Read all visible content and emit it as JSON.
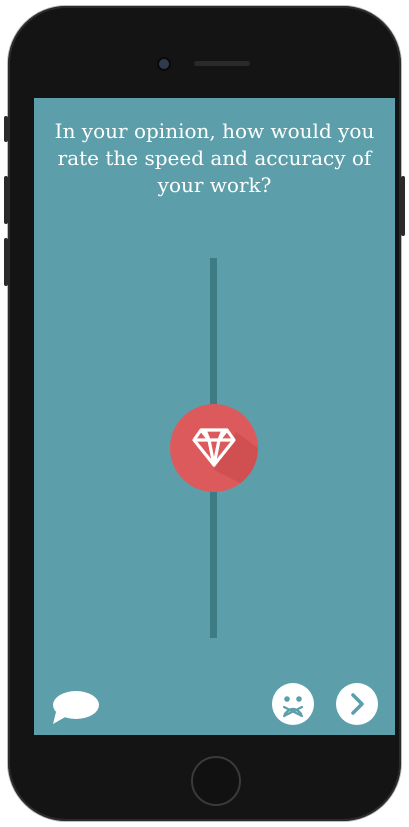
{
  "survey": {
    "question": "In your opinion, how would you rate the speed and accuracy of your work?"
  },
  "slider": {
    "thumb_icon": "diamond-icon",
    "value_fraction": 0.5
  },
  "controls": {
    "chat_icon": "speech-bubble-icon",
    "skip_icon": "sad-face-icon",
    "next_icon": "chevron-right-icon"
  },
  "colors": {
    "background": "#5c9faa",
    "track": "#3d7c84",
    "thumb": "#dd5a5c",
    "icon_fill": "#ffffff"
  }
}
